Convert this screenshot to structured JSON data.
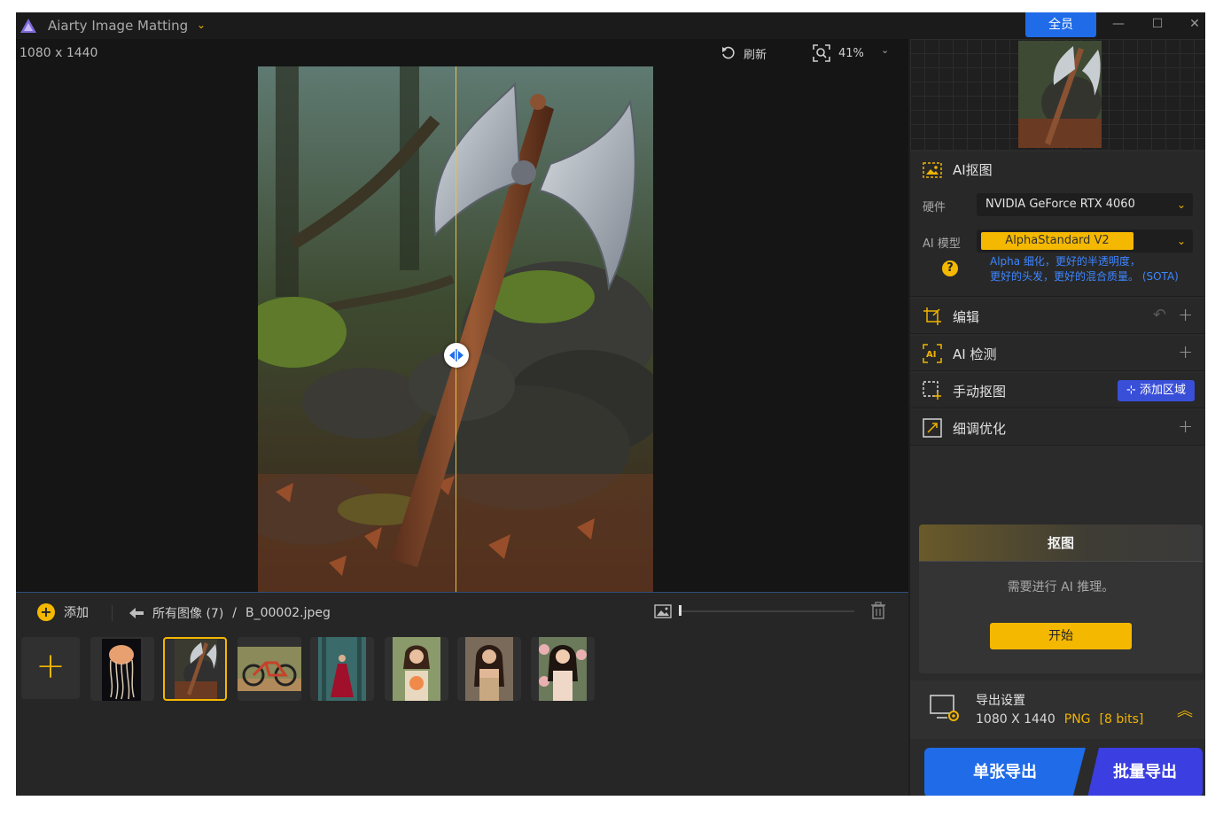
{
  "window": {
    "title": "Aiarty Image Matting",
    "upgrade_label": "全员"
  },
  "canvas": {
    "dimensions": "1080 x 1440",
    "refresh_label": "刷新",
    "zoom": "41%"
  },
  "bottom": {
    "add_label": "添加",
    "breadcrumb_all": "所有图像 (7)",
    "breadcrumb_sep": "/",
    "breadcrumb_file": "B_00002.jpeg",
    "thumbnails": [
      "jellyfish",
      "axe",
      "bicycle",
      "woman-red-dress",
      "woman-flowers",
      "woman-portrait",
      "woman-roses"
    ],
    "selected_index": 1
  },
  "panel": {
    "ai_matting": {
      "title": "AI抠图",
      "hardware_label": "硬件",
      "hardware_value": "NVIDIA GeForce RTX 4060",
      "model_label": "AI 模型",
      "model_value": "AlphaStandard  V2",
      "hint_line1": "Alpha 细化，更好的半透明度，",
      "hint_line2": "更好的头发，更好的混合质量。 (SOTA)"
    },
    "edit": {
      "title": "编辑"
    },
    "ai_detect": {
      "title": "AI 检测"
    },
    "manual": {
      "title": "手动抠图",
      "add_region_label": "添加区域"
    },
    "refine": {
      "title": "细调优化"
    },
    "matting_card": {
      "title": "抠图",
      "message": "需要进行 AI 推理。",
      "start_label": "开始"
    },
    "export": {
      "title": "导出设置",
      "size": "1080 X 1440",
      "format": "PNG",
      "bits": "[8 bits]"
    },
    "single_export_label": "单张导出",
    "batch_export_label": "批量导出"
  },
  "colors": {
    "accent": "#f5b800",
    "primary": "#1f6be8",
    "secondary": "#3b3ee0",
    "hint": "#3d86ff"
  }
}
